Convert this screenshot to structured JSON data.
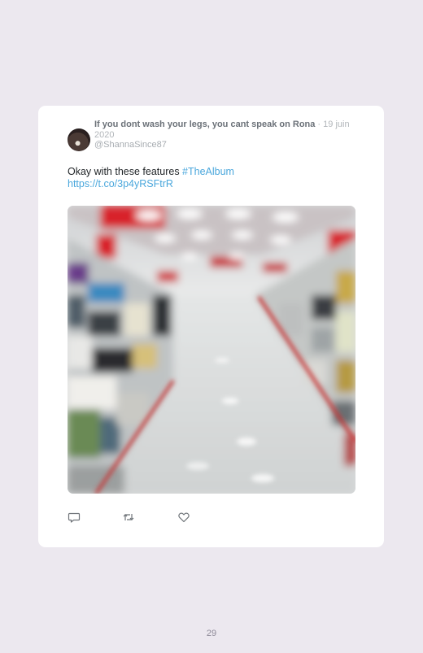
{
  "tweet": {
    "author_name": "If you dont wash your legs, you cant speak on Rona",
    "separator": " · ",
    "date": "19 juin 2020",
    "handle": "@ShannaSince87",
    "text_prefix": "Okay with these features ",
    "hashtag": "#TheAlbum",
    "url": "https://t.co/3p4yRSFtrR",
    "media_icon": "blurred-store-aisle-photo"
  },
  "actions": {
    "reply_icon": "reply-icon",
    "retweet_icon": "retweet-icon",
    "like_icon": "heart-icon"
  },
  "colors": {
    "page_bg": "#ece8ef",
    "card_bg": "#ffffff",
    "link": "#4aa7dc",
    "store_red": "#d8202a"
  },
  "page_number": "29"
}
